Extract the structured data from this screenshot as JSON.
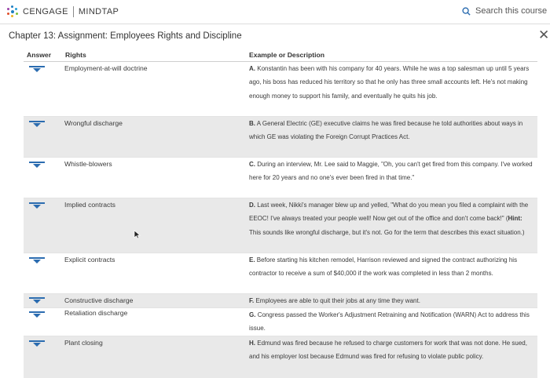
{
  "header": {
    "brand": "CENGAGE",
    "product": "MINDTAP",
    "search_placeholder": "Search this course"
  },
  "page_title": "Chapter 13: Assignment: Employees Rights and Discipline",
  "close_symbol": "✕",
  "table": {
    "columns": {
      "answer": "Answer",
      "rights": "Rights",
      "example": "Example or Description"
    },
    "rights": [
      "Employment-at-will doctrine",
      "Wrongful discharge",
      "Whistle-blowers",
      "Implied contracts",
      "Explicit contracts",
      "Constructive discharge",
      "Retaliation discharge",
      "Plant closing"
    ],
    "examples": [
      {
        "letter": "A.",
        "text": "Konstantin has been with his company for 40 years. While he was a top salesman up until 5 years ago, his boss has reduced his territory so that he only has three small accounts left. He's not making enough money to support his family, and eventually he quits his job."
      },
      {
        "letter": "B.",
        "text": "A General Electric (GE) executive claims he was fired because he told authorities about ways in which GE was violating the Foreign Corrupt Practices Act."
      },
      {
        "letter": "C.",
        "text": "During an interview, Mr. Lee said to Maggie, \"Oh, you can't get fired from this company. I've worked here for 20 years and no one's ever been fired in that time.\""
      },
      {
        "letter": "D.",
        "text_before": "Last week, Nikki's manager blew up and yelled, \"What do you mean you filed a complaint with the EEOC! I've always treated your people well! Now get out of the office and don't come back!\" (",
        "hint_label": "Hint:",
        "text_after": " This sounds like wrongful discharge, but it's not. Go for the term that describes this exact situation.)"
      },
      {
        "letter": "E.",
        "text": "Before starting his kitchen remodel, Harrison reviewed and signed the contract authorizing his contractor to receive a sum of $40,000 if the work was completed in less than 2 months."
      },
      {
        "letter": "F.",
        "text": "Employees are able to quit their jobs at any time they want."
      },
      {
        "letter": "G.",
        "text": "Congress passed the Worker's Adjustment Retraining and Notification (WARN) Act to address this issue."
      },
      {
        "letter": "H.",
        "text": "Edmund was fired because he refused to charge customers for work that was not done. He sued, and his employer lost because Edmund was fired for refusing to violate public policy."
      }
    ]
  },
  "colors": {
    "accent": "#2b6cb0",
    "row_shade": "#e9e9e9"
  }
}
